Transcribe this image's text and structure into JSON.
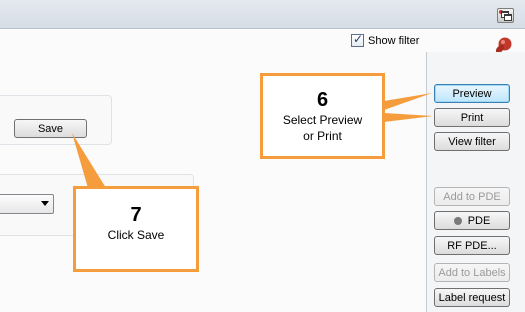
{
  "window": {
    "restore_icon": "restore-window-icon"
  },
  "filter": {
    "show_filter_label": "Show filter",
    "checked": true
  },
  "pin": {
    "icon": "pushpin-icon",
    "color": "#c0392b"
  },
  "form": {
    "save_label": "Save",
    "dropdown_value": ""
  },
  "side_buttons": {
    "preview": "Preview",
    "print": "Print",
    "view_filter": "View filter",
    "add_to_pde": "Add to PDE",
    "pde": "PDE",
    "rf_pde": "RF PDE...",
    "add_to_labels": "Add to Labels",
    "label_request": "Label request"
  },
  "callouts": {
    "step6": {
      "num": "6",
      "line1": "Select Preview",
      "line2": "or Print"
    },
    "step7": {
      "num": "7",
      "line1": "Click Save"
    }
  },
  "colors": {
    "callout_border": "#f59c3d",
    "focus_blue": "#3c7fb1"
  }
}
